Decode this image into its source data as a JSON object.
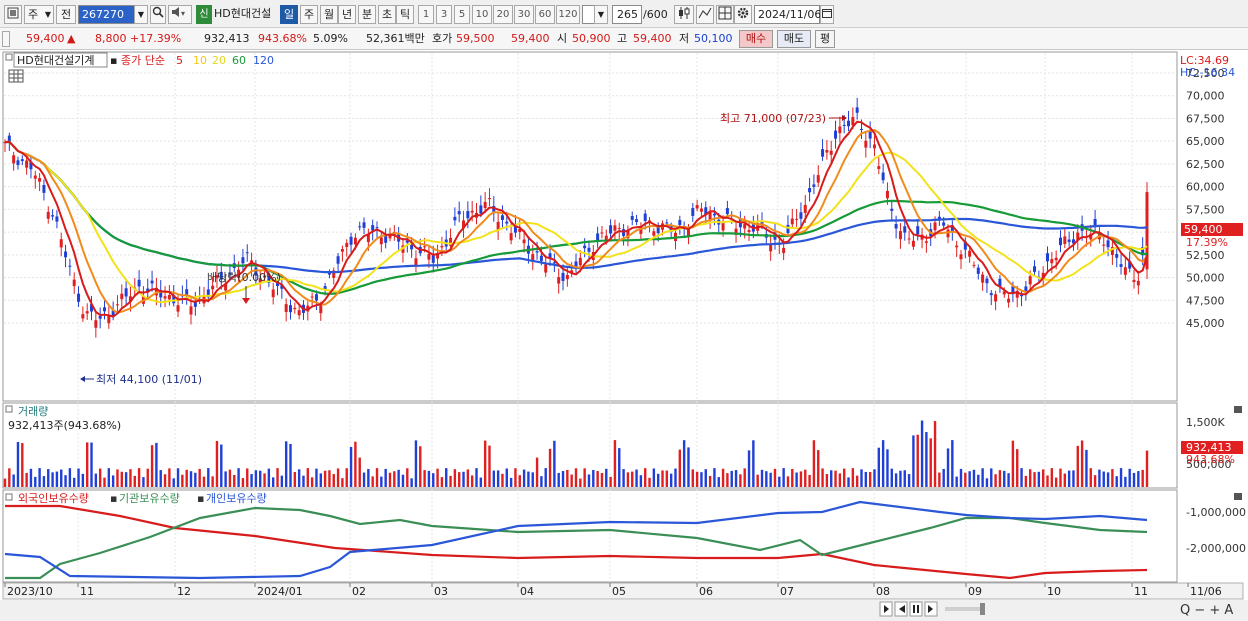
{
  "toolbar": {
    "period_main": "주",
    "prev_label": "전",
    "code": "267270",
    "sin_label": "신",
    "stock_name": "HD현대건설",
    "period_tabs": [
      "일",
      "주",
      "월",
      "년",
      "분",
      "초",
      "틱"
    ],
    "active_period": "일",
    "interval_buttons": [
      "1",
      "3",
      "5",
      "10",
      "20",
      "30",
      "60",
      "120"
    ],
    "count": "265",
    "count_total": "/600",
    "date": "2024/11/06"
  },
  "quote": {
    "price": "59,400",
    "change_arrow": "▲",
    "change": "8,800",
    "change_pct": "+17.39%",
    "volume": "932,413",
    "volume_ratio": "943.68%",
    "turnover_pct": "5.09%",
    "amount": "52,361백만",
    "ask_label": "호가",
    "ask1": "59,500",
    "ask2": "59,400",
    "open_label": "시",
    "open": "50,900",
    "high_label": "고",
    "high": "59,400",
    "low_label": "저",
    "low": "50,100",
    "buy_label": "매수",
    "sell_label": "매도",
    "eval_label": "평"
  },
  "price_panel": {
    "stock_tag": "HD현대건설기계",
    "ma_prefix": "종가 단순",
    "ma_periods": [
      "5",
      "10",
      "20",
      "60",
      "120"
    ],
    "lc_text": "LC:34.69",
    "hc_text": "HC:-16.34",
    "high_annotation": "최고 71,000 (07/23)",
    "low_annotation": "최저 44,100 (11/01)",
    "dividend_annotation": "배당락(0.00%)",
    "current_price_label": "59,400",
    "current_pct_label": "17.39%",
    "y_ticks": [
      "72,500",
      "70,000",
      "67,500",
      "65,000",
      "62,500",
      "60,000",
      "57,500",
      "55,000",
      "52,500",
      "50,000",
      "47,500",
      "45,000"
    ]
  },
  "volume_panel": {
    "title": "거래량",
    "summary": "932,413주(943.68%)",
    "y_ticks": [
      "1,500K",
      "500,000"
    ],
    "current_label": "932,413",
    "current_pct_label": "943.68%"
  },
  "holder_panel": {
    "series_labels": [
      "외국인보유수량",
      "기관보유수량",
      "개인보유수량"
    ],
    "y_ticks": [
      "-1,000,000",
      "-2,000,000"
    ]
  },
  "x_axis": {
    "labels": [
      "2023/10",
      "11",
      "12",
      "2024/01",
      "02",
      "03",
      "04",
      "05",
      "06",
      "07",
      "08",
      "09",
      "10",
      "11",
      "11/06"
    ]
  },
  "colors": {
    "up": "#e02020",
    "down": "#1f3fd6",
    "ma5": "#d81b1b",
    "ma10": "#f08c1c",
    "ma20": "#f2e21a",
    "ma60": "#179a38",
    "ma120": "#2a56d8",
    "foreign": "#d81b1b",
    "institution": "#3b8f56",
    "individual": "#2a56d8"
  },
  "icons": [
    "chart-type-icon",
    "search-icon",
    "sound-icon",
    "candle-icon",
    "drawing-icon",
    "crosshair-icon",
    "settings-icon",
    "calendar-icon",
    "config-icon"
  ]
}
